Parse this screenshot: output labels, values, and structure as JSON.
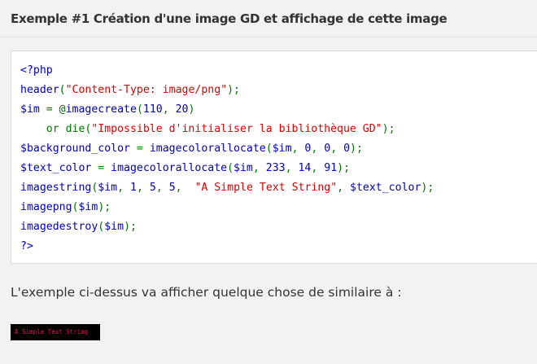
{
  "title": "Exemple #1 Création d'une image GD et affichage de cette image",
  "colors": {
    "default": "#0000bb",
    "keyword": "#007700",
    "string": "#dd0000",
    "image_text": "#e90e5b",
    "image_bg": "#000000"
  },
  "code_lines": [
    [
      [
        "d",
        "<?php"
      ]
    ],
    [
      [
        "d",
        "header"
      ],
      [
        "k",
        "("
      ],
      [
        "s",
        "\"Content-Type: image/png\""
      ],
      [
        "k",
        ");"
      ]
    ],
    [
      [
        "d",
        "$im "
      ],
      [
        "k",
        "= @"
      ],
      [
        "d",
        "imagecreate"
      ],
      [
        "k",
        "("
      ],
      [
        "d",
        "110"
      ],
      [
        "k",
        ", "
      ],
      [
        "d",
        "20"
      ],
      [
        "k",
        ")"
      ]
    ],
    [
      [
        "k",
        "    or die("
      ],
      [
        "s",
        "\"Impossible d'initialiser la bibliothèque GD\""
      ],
      [
        "k",
        ");"
      ]
    ],
    [
      [
        "d",
        "$background_color "
      ],
      [
        "k",
        "= "
      ],
      [
        "d",
        "imagecolorallocate"
      ],
      [
        "k",
        "("
      ],
      [
        "d",
        "$im"
      ],
      [
        "k",
        ", "
      ],
      [
        "d",
        "0"
      ],
      [
        "k",
        ", "
      ],
      [
        "d",
        "0"
      ],
      [
        "k",
        ", "
      ],
      [
        "d",
        "0"
      ],
      [
        "k",
        ");"
      ]
    ],
    [
      [
        "d",
        "$text_color "
      ],
      [
        "k",
        "= "
      ],
      [
        "d",
        "imagecolorallocate"
      ],
      [
        "k",
        "("
      ],
      [
        "d",
        "$im"
      ],
      [
        "k",
        ", "
      ],
      [
        "d",
        "233"
      ],
      [
        "k",
        ", "
      ],
      [
        "d",
        "14"
      ],
      [
        "k",
        ", "
      ],
      [
        "d",
        "91"
      ],
      [
        "k",
        ");"
      ]
    ],
    [
      [
        "d",
        "imagestring"
      ],
      [
        "k",
        "("
      ],
      [
        "d",
        "$im"
      ],
      [
        "k",
        ", "
      ],
      [
        "d",
        "1"
      ],
      [
        "k",
        ", "
      ],
      [
        "d",
        "5"
      ],
      [
        "k",
        ", "
      ],
      [
        "d",
        "5"
      ],
      [
        "k",
        ",  "
      ],
      [
        "s",
        "\"A Simple Text String\""
      ],
      [
        "k",
        ", "
      ],
      [
        "d",
        "$text_color"
      ],
      [
        "k",
        ");"
      ]
    ],
    [
      [
        "d",
        "imagepng"
      ],
      [
        "k",
        "("
      ],
      [
        "d",
        "$im"
      ],
      [
        "k",
        ");"
      ]
    ],
    [
      [
        "d",
        "imagedestroy"
      ],
      [
        "k",
        "("
      ],
      [
        "d",
        "$im"
      ],
      [
        "k",
        ");"
      ]
    ],
    [
      [
        "d",
        "?>"
      ]
    ]
  ],
  "output_text": "L'exemple ci-dessus va afficher quelque chose de similaire à :",
  "output_image_text": "A Simple Text String"
}
